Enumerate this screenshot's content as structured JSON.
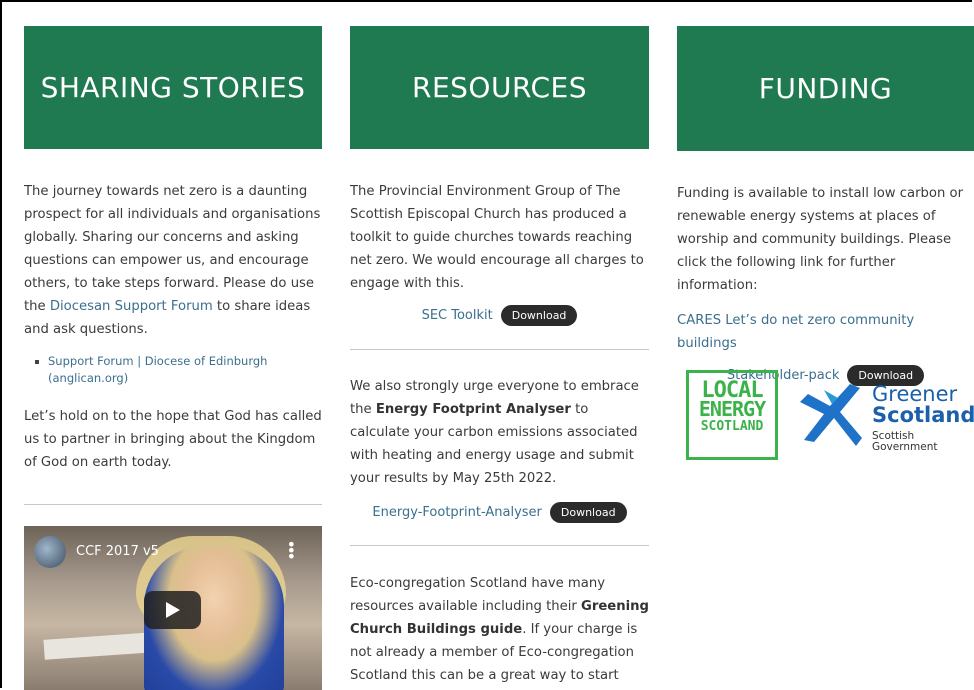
{
  "columns": {
    "sharing": {
      "title": "SHARING STORIES",
      "intro_pre": "The journey towards net zero is a daunting prospect for all individuals and organisations globally. Sharing our concerns and asking questions can empower us, and encourage others, to take steps forward. Please do use the ",
      "intro_link": "Diocesan Support Forum",
      "intro_post": " to share ideas and ask questions.",
      "bullets": [
        "Support Forum | Diocese of Edinburgh (anglican.org)"
      ],
      "hope": "Let’s hold on to the hope that God has called us to partner in bringing about the Kingdom of God on earth today.",
      "video_title": "CCF 2017 v5"
    },
    "resources": {
      "title": "RESOURCES",
      "intro": "The Provincial Environment Group of The Scottish Episcopal Church has produced a toolkit to guide churches towards reaching net zero. We would encourage all charges to engage with this.",
      "toolkit_label": "SEC Toolkit",
      "download_label": "Download",
      "efa_pre": "We also strongly urge everyone to embrace the ",
      "efa_bold": "Energy Footprint Analyser",
      "efa_post": " to calculate your carbon emissions associated with heating and energy usage and submit your results by May 25th 2022.",
      "efa_label": "Energy-Footprint-Analyser",
      "eco_pre": "Eco-congregation Scotland have many resources available including their ",
      "eco_bold": "Greening Church Buildings guide",
      "eco_post": ". If your charge is not already a member of Eco-congregation Scotland this can be a great way to start"
    },
    "funding": {
      "title": "FUNDING",
      "intro": "Funding is available to install low carbon or renewable energy systems at places of worship and community buildings.  Please click the following link for further information:",
      "cares_link": "CARES Let’s do net zero community buildings",
      "stakeholder_label": "Stakeholder-pack",
      "download_label": "Download",
      "les_lines": [
        "LOCAL",
        "ENERGY",
        "SCOTLAND"
      ],
      "gs_line1": "Greener",
      "gs_line2": "Scotland",
      "gs_line3": "Scottish",
      "gs_line4": "Government"
    }
  },
  "colors": {
    "header_green": "#1f7a52",
    "link_blue": "#3b6f8e",
    "button_dark": "#2b2b2b"
  }
}
